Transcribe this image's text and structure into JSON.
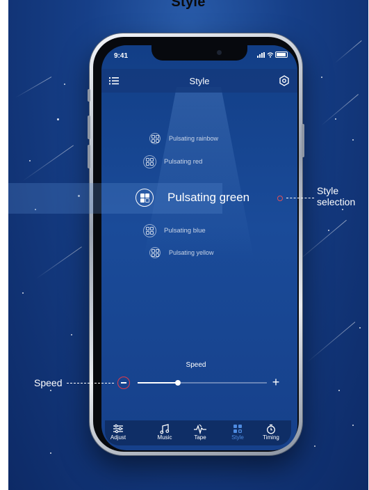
{
  "header_text": "Style",
  "status": {
    "time": "9:41"
  },
  "navbar": {
    "title": "Style",
    "menu_icon": "list-icon",
    "settings_icon": "settings-icon"
  },
  "styles": {
    "list": [
      {
        "label": "Pulsating rainbow"
      },
      {
        "label": "Pulsating red"
      },
      {
        "label": "Pulsating green"
      },
      {
        "label": "Pulsating blue"
      },
      {
        "label": "Pulsating yellow"
      }
    ],
    "selected": "Pulsating green"
  },
  "speed": {
    "label": "Speed",
    "value_fraction": 0.31
  },
  "tabs": [
    {
      "label": "Adjust",
      "icon": "sliders-icon"
    },
    {
      "label": "Music",
      "icon": "music-note-icon"
    },
    {
      "label": "Tape",
      "icon": "tape-icon"
    },
    {
      "label": "Style",
      "icon": "style-grid-icon",
      "active": true
    },
    {
      "label": "Timing",
      "icon": "timer-icon"
    }
  ],
  "annotations": {
    "style_selection": "Style\nselection",
    "speed": "Speed"
  },
  "colors": {
    "accent": "#4e8be0",
    "minus_ring": "#e03a4a",
    "background": "#163f88"
  }
}
